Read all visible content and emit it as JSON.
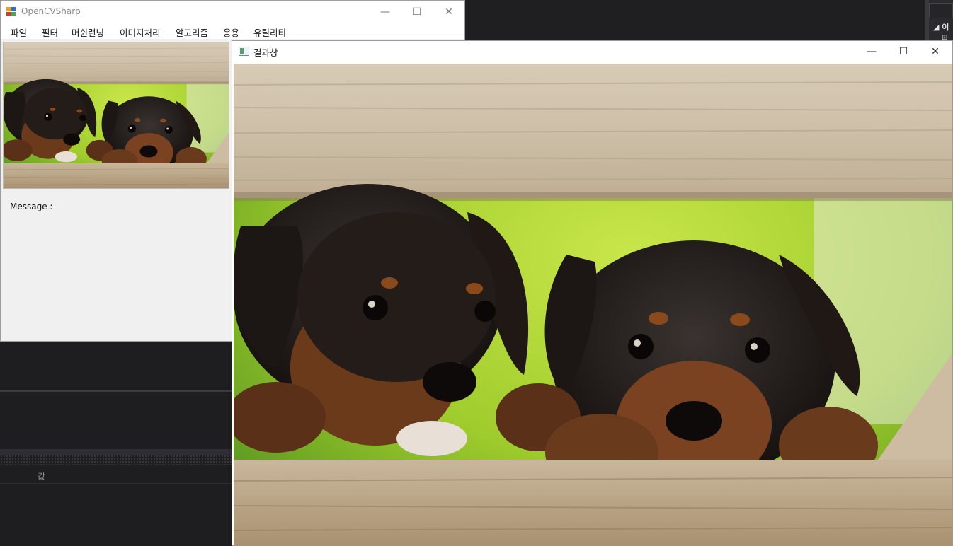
{
  "main_window": {
    "title": "OpenCVSharp",
    "minimize_glyph": "—",
    "maximize_glyph": "☐",
    "close_glyph": "✕",
    "menu": [
      {
        "label": "파일"
      },
      {
        "label": "필터"
      },
      {
        "label": "머쉰런닝"
      },
      {
        "label": "이미지처리"
      },
      {
        "label": "알고리즘"
      },
      {
        "label": "응용"
      },
      {
        "label": "유틸리티"
      }
    ],
    "message_label": "Message :"
  },
  "result_window": {
    "title": "결과창",
    "minimize_glyph": "—",
    "maximize_glyph": "☐",
    "close_glyph": "✕"
  },
  "ide": {
    "property_value_header": "값",
    "right_panel_label": "◢ 이",
    "right_panel_icon": "⊞"
  },
  "icons": {
    "app": "windows-forms-app-icon",
    "result": "form-window-icon",
    "image": "two-puppies-behind-wooden-fence"
  },
  "colors": {
    "ide_background": "#1e1e20",
    "window_chrome": "#ffffff",
    "form_background": "#f0f0f0",
    "accent_blue": "#2c7fd6"
  }
}
